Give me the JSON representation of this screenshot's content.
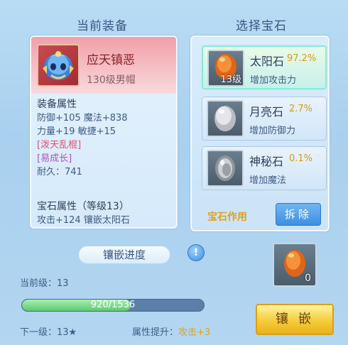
{
  "headers": {
    "current_equipment": "当前装备",
    "choose_gem": "选择宝石"
  },
  "equipment": {
    "name": "应天镇恶",
    "subtitle": "130级男帽",
    "attr_title": "装备属性",
    "attr_line1": "防御+105 魔法+838",
    "attr_line2": "力量+19 敏捷+15",
    "special1": "[泼天乱棍]",
    "special2": "[易成长]",
    "durability": "耐久：741",
    "gem_attr_title": "宝石属性（等级13）",
    "gem_attr_line": "攻击+124 镶嵌太阳石"
  },
  "gems": [
    {
      "name": "太阳石",
      "pct": "97.2%",
      "desc": "增加攻击力",
      "level": "13级",
      "icon": "sun-stone-icon"
    },
    {
      "name": "月亮石",
      "pct": "2.7%",
      "desc": "增加防御力",
      "level": "",
      "icon": "moon-stone-icon"
    },
    {
      "name": "神秘石",
      "pct": "0.1%",
      "desc": "增加魔法",
      "level": "",
      "icon": "mystery-stone-icon"
    }
  ],
  "gem_effect": "宝石作用",
  "remove_label": "拆除",
  "progress": {
    "title": "镶嵌进度",
    "info_icon": "!",
    "current_level": "当前级：13",
    "value_text": "920/1536",
    "current": 920,
    "total": 1536,
    "next_level": "下一级：13★",
    "boost_label": "属性提升：",
    "boost_value": "攻击+3"
  },
  "selected_gem_count": "0",
  "inlay_label": "镶嵌",
  "colors": {
    "progress_fill": "#5fc86f",
    "accent_gold": "#e0a11a",
    "button_blue": "#3f8fe0"
  }
}
